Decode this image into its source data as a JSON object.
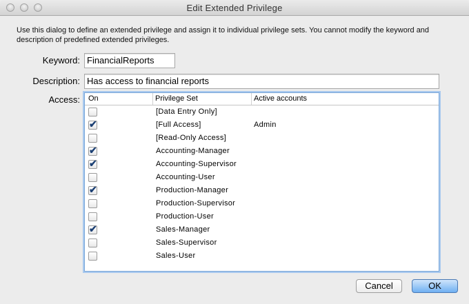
{
  "window": {
    "title": "Edit Extended Privilege"
  },
  "intro": "Use this dialog to define an extended privilege and assign it to individual privilege sets. You cannot modify the keyword and description of predefined extended privileges.",
  "keyword": {
    "label": "Keyword:",
    "value": "FinancialReports"
  },
  "description": {
    "label": "Description:",
    "value": "Has access to financial reports"
  },
  "access": {
    "label": "Access:",
    "columns": {
      "on": "On",
      "privilege_set": "Privilege Set",
      "active_accounts": "Active accounts"
    },
    "rows": [
      {
        "on": false,
        "privilege_set": "[Data Entry Only]",
        "active_accounts": ""
      },
      {
        "on": true,
        "privilege_set": "[Full Access]",
        "active_accounts": "Admin"
      },
      {
        "on": false,
        "privilege_set": "[Read-Only Access]",
        "active_accounts": ""
      },
      {
        "on": true,
        "privilege_set": "Accounting-Manager",
        "active_accounts": ""
      },
      {
        "on": true,
        "privilege_set": "Accounting-Supervisor",
        "active_accounts": ""
      },
      {
        "on": false,
        "privilege_set": "Accounting-User",
        "active_accounts": ""
      },
      {
        "on": true,
        "privilege_set": "Production-Manager",
        "active_accounts": ""
      },
      {
        "on": false,
        "privilege_set": "Production-Supervisor",
        "active_accounts": ""
      },
      {
        "on": false,
        "privilege_set": "Production-User",
        "active_accounts": ""
      },
      {
        "on": true,
        "privilege_set": "Sales-Manager",
        "active_accounts": ""
      },
      {
        "on": false,
        "privilege_set": "Sales-Supervisor",
        "active_accounts": ""
      },
      {
        "on": false,
        "privilege_set": "Sales-User",
        "active_accounts": ""
      }
    ]
  },
  "buttons": {
    "cancel": "Cancel",
    "ok": "OK"
  },
  "colors": {
    "focus_ring": "#a9c9ee",
    "default_button": "#6fb0f2",
    "checkmark": "#1b3f73"
  }
}
